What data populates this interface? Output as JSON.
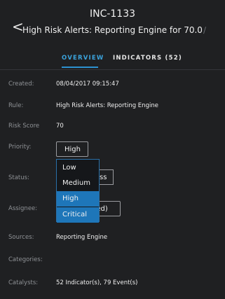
{
  "header": {
    "back_icon": "chevron-left-icon",
    "incident_id": "INC-1133",
    "title": "High Risk Alerts: Reporting Engine for 70.0",
    "edit_icon": "pencil-icon"
  },
  "tabs": [
    {
      "label": "OVERVIEW",
      "active": true
    },
    {
      "label": "INDICATORS (52)",
      "active": false
    }
  ],
  "fields": {
    "created": {
      "label": "Created:",
      "value": "08/04/2017 09:15:47"
    },
    "rule": {
      "label": "Rule:",
      "value": "High Risk Alerts: Reporting Engine"
    },
    "risk_score": {
      "label": "Risk Score",
      "value": "70"
    },
    "priority": {
      "label": "Priority:",
      "value": "High"
    },
    "status": {
      "label": "Status:",
      "value_visible": "ss"
    },
    "assignee": {
      "label": "Assignee:",
      "value_visible": "ned)"
    },
    "sources": {
      "label": "Sources:",
      "value": "Reporting Engine"
    },
    "categories": {
      "label": "Categories:",
      "value": ""
    },
    "catalysts": {
      "label": "Catalysts:",
      "value": "52 Indicator(s), 79 Event(s)"
    }
  },
  "priority_dropdown": {
    "options": [
      "Low",
      "Medium",
      "High",
      "Critical"
    ],
    "highlighted": [
      "High",
      "Critical"
    ]
  },
  "colors": {
    "accent": "#3ba3dc",
    "selected": "#1e76b9",
    "background": "#1f2022"
  }
}
